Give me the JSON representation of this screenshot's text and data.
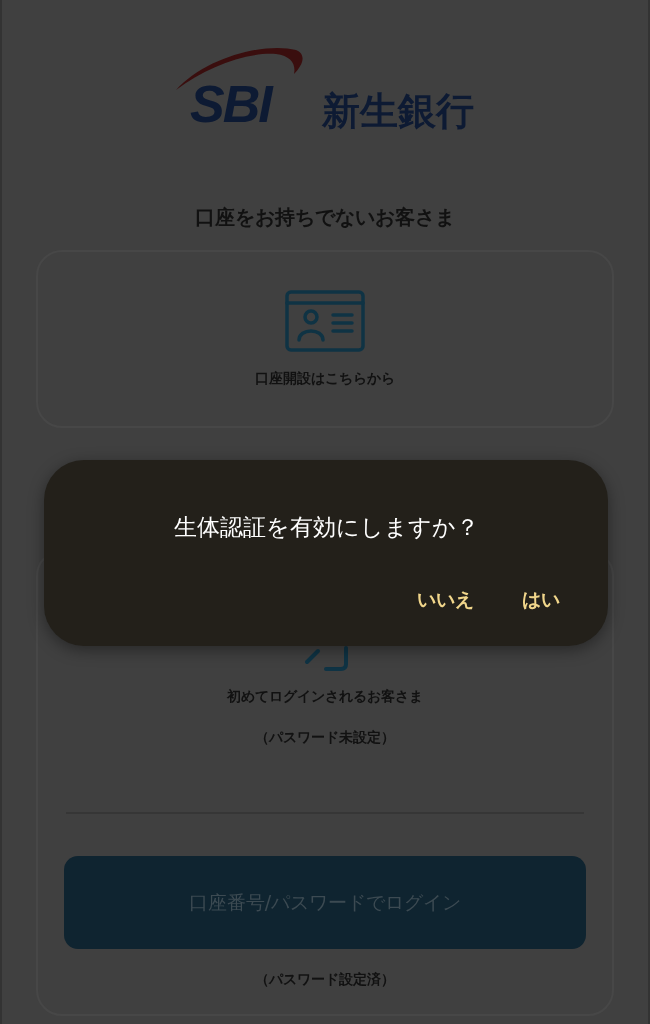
{
  "logo": {
    "mark": "SBI",
    "name": "新生銀行"
  },
  "new_customer": {
    "heading": "口座をお持ちでないお客さま",
    "card_label": "口座開設はこちらから"
  },
  "login": {
    "first_time": "初めてログインされるお客さま",
    "first_time_note": "（パスワード未設定）",
    "button": "口座番号/パスワードでログイン",
    "button_note": "（パスワード設定済）"
  },
  "dialog": {
    "message": "生体認証を有効にしますか？",
    "buttons": [
      {
        "label": "いいえ"
      },
      {
        "label": "はい"
      }
    ]
  }
}
